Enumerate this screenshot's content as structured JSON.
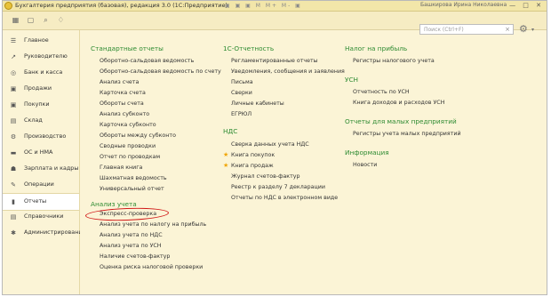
{
  "window": {
    "title": "Бухгалтерия предприятия (базовая), редакция 3.0 (1С:Предприятие)",
    "toolbar_glyphs": "▣ ▣ ▣ M M+ M- ▣",
    "user": "Башкирова Ирина Николаевна",
    "controls": "— □ ✕"
  },
  "toolbar": {
    "icons": [
      "apps-grid-icon",
      "window-icon",
      "search-icon",
      "bell-icon"
    ]
  },
  "sidebar": {
    "items": [
      {
        "label": "Главное",
        "icon": "☰"
      },
      {
        "label": "Руководителю",
        "icon": "↗"
      },
      {
        "label": "Банк и касса",
        "icon": "◎"
      },
      {
        "label": "Продажи",
        "icon": "▣"
      },
      {
        "label": "Покупки",
        "icon": "▣"
      },
      {
        "label": "Склад",
        "icon": "▤"
      },
      {
        "label": "Производство",
        "icon": "⚙"
      },
      {
        "label": "ОС и НМА",
        "icon": "▬"
      },
      {
        "label": "Зарплата и кадры",
        "icon": "☗"
      },
      {
        "label": "Операции",
        "icon": "✎"
      },
      {
        "label": "Отчеты",
        "icon": "▮"
      },
      {
        "label": "Справочники",
        "icon": "▤"
      },
      {
        "label": "Администрирование",
        "icon": "✱"
      }
    ]
  },
  "search": {
    "placeholder": "Поиск (Ctrl+F)"
  },
  "sections": {
    "standard": {
      "title": "Стандартные отчеты",
      "links": [
        "Оборотно-сальдовая ведомость",
        "Оборотно-сальдовая ведомость по счету",
        "Анализ счета",
        "Карточка счета",
        "Обороты счета",
        "Анализ субконто",
        "Карточка субконто",
        "Обороты между субконто",
        "Сводные проводки",
        "Отчет по проводкам",
        "Главная книга",
        "Шахматная ведомость",
        "Универсальный отчет"
      ]
    },
    "analysis": {
      "title": "Анализ учета",
      "links": [
        "Экспресс-проверка",
        "Анализ учета по налогу на прибыль",
        "Анализ учета по НДС",
        "Анализ учета по УСН",
        "Наличие счетов-фактур",
        "Оценка риска налоговой проверки"
      ]
    },
    "reporting": {
      "title": "1С-Отчетность",
      "links": [
        "Регламентированные отчеты",
        "Уведомления, сообщения и заявления",
        "Письма",
        "Сверки",
        "Личные кабинеты",
        "ЕГРЮЛ"
      ]
    },
    "vat": {
      "title": "НДС",
      "links": [
        "Сверка данных учета НДС",
        "Книга покупок",
        "Книга продаж",
        "Журнал счетов-фактур",
        "Реестр к разделу 7 декларации",
        "Отчеты по НДС в электронном виде"
      ]
    },
    "profit": {
      "title": "Налог на прибыль",
      "links": [
        "Регистры налогового учета"
      ]
    },
    "usn": {
      "title": "УСН",
      "links": [
        "Отчетность по УСН",
        "Книга доходов и расходов УСН"
      ]
    },
    "small": {
      "title": "Отчеты для малых предприятий",
      "links": [
        "Регистры учета малых предприятий"
      ]
    },
    "info": {
      "title": "Информация",
      "links": [
        "Новости"
      ]
    }
  },
  "colors": {
    "heading": "#2e8b32",
    "background": "#fbf4d6",
    "highlight": "#d01818",
    "star": "#f0a500"
  }
}
